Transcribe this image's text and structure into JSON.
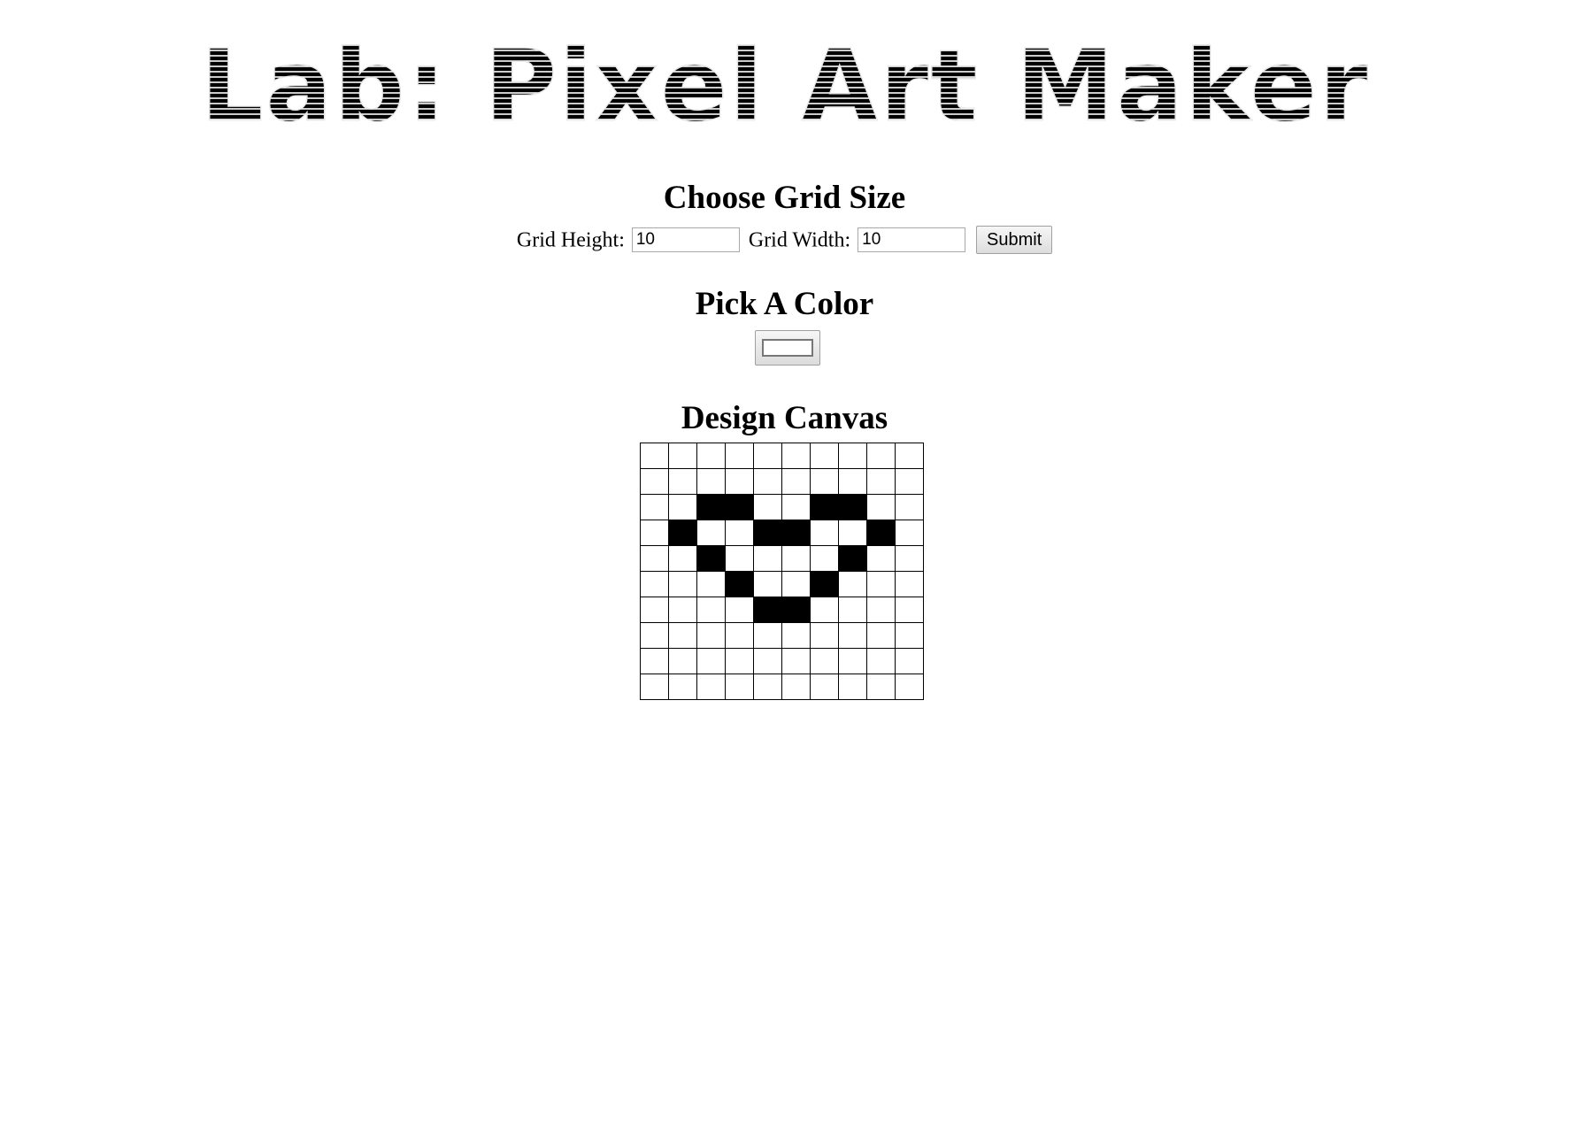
{
  "logo": {
    "text": "Lab: Pixel Art Maker"
  },
  "grid_section": {
    "title": "Choose Grid Size",
    "height_label": "Grid Height:",
    "height_value": "10",
    "width_label": "Grid Width:",
    "width_value": "10",
    "submit_label": "Submit"
  },
  "color_section": {
    "title": "Pick A Color",
    "selected_color": "#ffffff"
  },
  "canvas_section": {
    "title": "Design Canvas",
    "rows": 10,
    "cols": 10,
    "fill_color": "#000000",
    "filled_cells": [
      [
        2,
        2
      ],
      [
        2,
        3
      ],
      [
        2,
        6
      ],
      [
        2,
        7
      ],
      [
        3,
        1
      ],
      [
        3,
        4
      ],
      [
        3,
        5
      ],
      [
        3,
        8
      ],
      [
        4,
        2
      ],
      [
        4,
        7
      ],
      [
        5,
        3
      ],
      [
        5,
        6
      ],
      [
        6,
        4
      ],
      [
        6,
        5
      ]
    ]
  }
}
